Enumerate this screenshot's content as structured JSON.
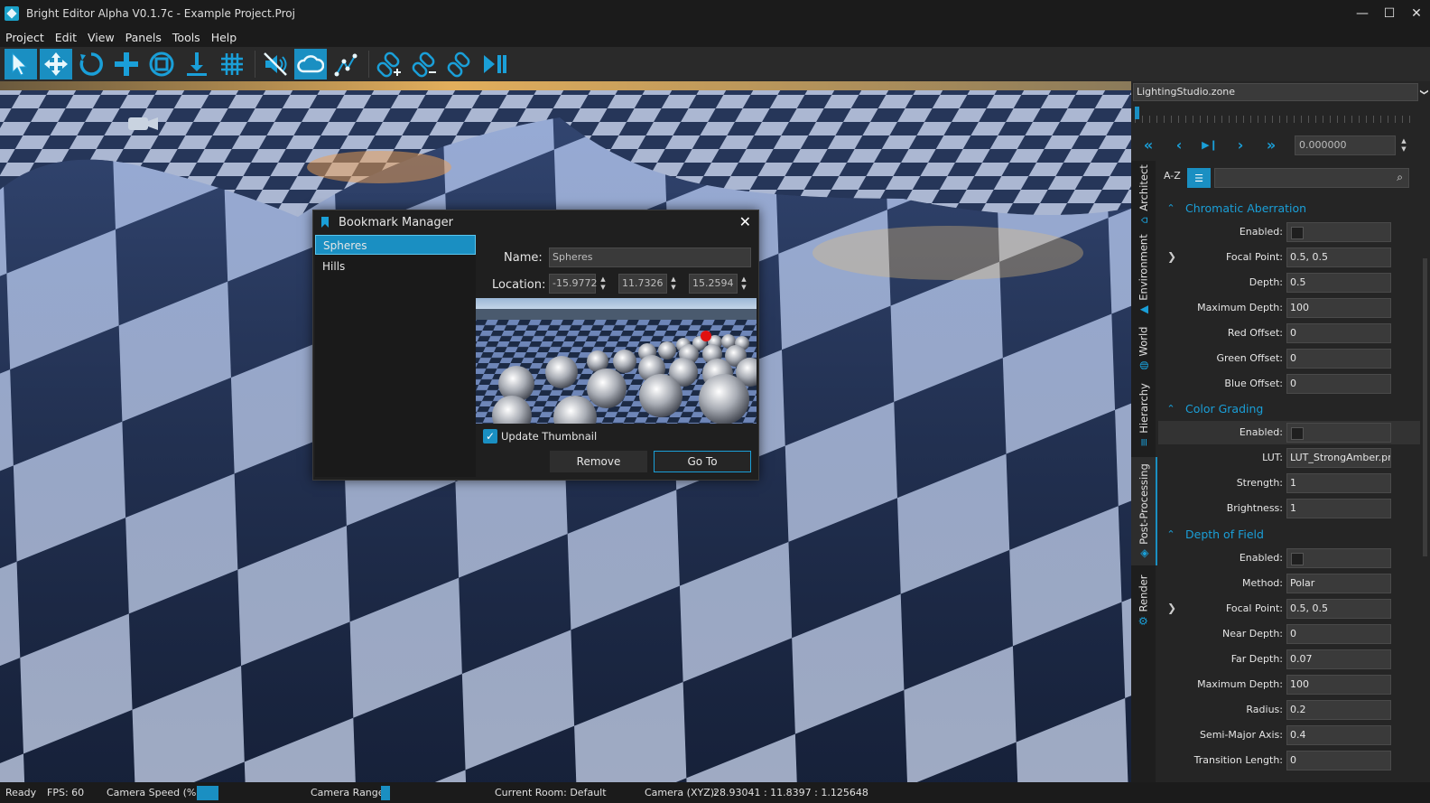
{
  "window": {
    "title": "Bright Editor Alpha V0.1.7c - Example Project.Proj",
    "minimize": "—",
    "maximize": "☐",
    "close": "✕"
  },
  "menu": [
    "Project",
    "Edit",
    "View",
    "Panels",
    "Tools",
    "Help"
  ],
  "toolbar": {
    "tools": [
      "select-tool-icon",
      "move-tool-icon",
      "rotate-tool-icon",
      "translate-tool-icon",
      "scale-tool-icon",
      "drop-to-ground-icon",
      "grid-snap-icon",
      "mute-audio-icon",
      "cloud-icon",
      "path-tool-icon",
      "link-add-icon",
      "link-remove-icon",
      "link-icon",
      "play-pause-icon"
    ],
    "accent": "#1a9fd8"
  },
  "bookmark_manager": {
    "title": "Bookmark Manager",
    "close": "✕",
    "bookmarks": [
      "Spheres",
      "Hills"
    ],
    "selected": "Spheres",
    "name_label": "Name:",
    "name_value": "Spheres",
    "location_label": "Location:",
    "location_x": "-15.9772",
    "location_y": "11.7326",
    "location_z": "15.2594",
    "update_thumbnail_label": "Update Thumbnail",
    "update_thumbnail_checked": true,
    "check_mark": "✓",
    "remove_label": "Remove",
    "goto_label": "Go To"
  },
  "right_panel": {
    "zone": "LightingStudio.zone",
    "zone_arrow": "❯",
    "time_value": "0.000000",
    "play_buttons": [
      "«",
      "‹",
      "▶❙",
      "›",
      "»"
    ],
    "tabs": [
      {
        "label": "Architect",
        "icon": "architect-icon",
        "glyph": "⌂"
      },
      {
        "label": "Environment",
        "icon": "environment-icon",
        "glyph": "▲"
      },
      {
        "label": "World",
        "icon": "world-icon",
        "glyph": "◍"
      },
      {
        "label": "Hierarchy",
        "icon": "hierarchy-icon",
        "glyph": "≡"
      },
      {
        "label": "Post-Processing",
        "icon": "post-processing-icon",
        "glyph": "◈"
      },
      {
        "label": "Render",
        "icon": "render-gear-icon",
        "glyph": "⚙"
      }
    ],
    "active_tab": "Post-Processing",
    "sort_label": "A-Z",
    "category_glyph": "☰",
    "search_glyph": "⌕",
    "sections": [
      {
        "title": "Chromatic Aberration",
        "collapse_glyph": "⌃",
        "props": [
          {
            "label": "Enabled:",
            "type": "checkbox",
            "value": false
          },
          {
            "label": "Focal Point:",
            "type": "text",
            "value": "0.5, 0.5",
            "expandable": true
          },
          {
            "label": "Depth:",
            "type": "text",
            "value": "0.5"
          },
          {
            "label": "Maximum Depth:",
            "type": "text",
            "value": "100"
          },
          {
            "label": "Red Offset:",
            "type": "text",
            "value": "0"
          },
          {
            "label": "Green Offset:",
            "type": "text",
            "value": "0"
          },
          {
            "label": "Blue Offset:",
            "type": "text",
            "value": "0"
          }
        ]
      },
      {
        "title": "Color Grading",
        "collapse_glyph": "⌃",
        "props": [
          {
            "label": "Enabled:",
            "type": "checkbox",
            "value": false,
            "highlight": true
          },
          {
            "label": "LUT:",
            "type": "text",
            "value": "LUT_StrongAmber.pn"
          },
          {
            "label": "Strength:",
            "type": "text",
            "value": "1"
          },
          {
            "label": "Brightness:",
            "type": "text",
            "value": "1"
          }
        ]
      },
      {
        "title": "Depth of Field",
        "collapse_glyph": "⌃",
        "props": [
          {
            "label": "Enabled:",
            "type": "checkbox",
            "value": false
          },
          {
            "label": "Method:",
            "type": "text",
            "value": "Polar"
          },
          {
            "label": "Focal Point:",
            "type": "text",
            "value": "0.5, 0.5",
            "expandable": true
          },
          {
            "label": "Near Depth:",
            "type": "text",
            "value": "0"
          },
          {
            "label": "Far Depth:",
            "type": "text",
            "value": "0.07"
          },
          {
            "label": "Maximum Depth:",
            "type": "text",
            "value": "100"
          },
          {
            "label": "Radius:",
            "type": "text",
            "value": "0.2"
          },
          {
            "label": "Semi-Major Axis:",
            "type": "text",
            "value": "0.4"
          },
          {
            "label": "Transition Length:",
            "type": "text",
            "value": "0"
          }
        ]
      }
    ]
  },
  "status": {
    "ready": "Ready",
    "fps": "FPS: 60",
    "camera_speed": "Camera  Speed (%):",
    "camera_range": "Camera Range:",
    "room": "Current Room: Default",
    "camera_xyz_label": "Camera (XYZ):",
    "camera_xyz": "28.93041 : 11.8397 : 1.125648"
  }
}
